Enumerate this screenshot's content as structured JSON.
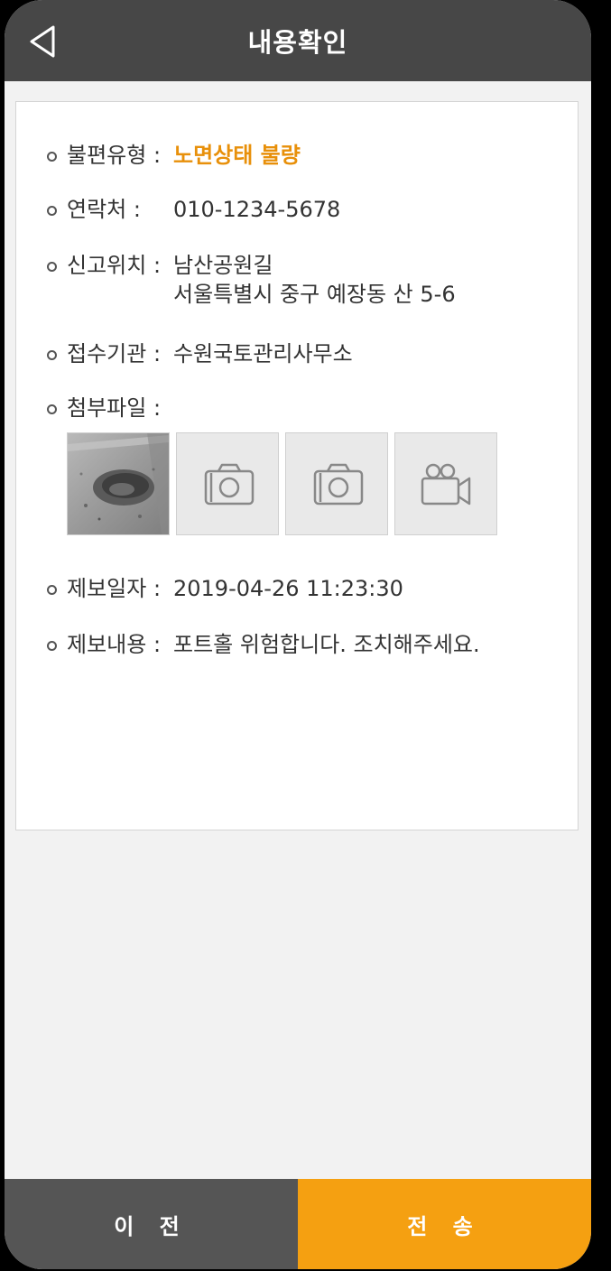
{
  "header": {
    "title": "내용확인",
    "back_icon": "back-arrow-icon"
  },
  "details": {
    "type_label": "불편유형 :",
    "type_value": "노면상태 불량",
    "contact_label": "연락처 :",
    "contact_value": "010-1234-5678",
    "location_label": "신고위치 :",
    "location_line1": "남산공원길",
    "location_line2": "서울특별시 중구 예장동 산 5-6",
    "agency_label": "접수기관 :",
    "agency_value": "수원국토관리사무소",
    "attachment_label": "첨부파일 :",
    "attachments": [
      {
        "type": "photo",
        "icon": "pothole-photo"
      },
      {
        "type": "empty-photo",
        "icon": "camera-icon"
      },
      {
        "type": "empty-photo",
        "icon": "camera-icon"
      },
      {
        "type": "empty-video",
        "icon": "video-camera-icon"
      }
    ],
    "date_label": "제보일자 :",
    "date_value": "2019-04-26 11:23:30",
    "content_label": "제보내용 :",
    "content_value": "포트홀 위험합니다. 조치해주세요."
  },
  "footer": {
    "prev_label": "이 전",
    "send_label": "전 송"
  },
  "colors": {
    "header_bg": "#474747",
    "accent": "#f5a011",
    "highlight_text": "#e8900a",
    "prev_bg": "#555555"
  }
}
